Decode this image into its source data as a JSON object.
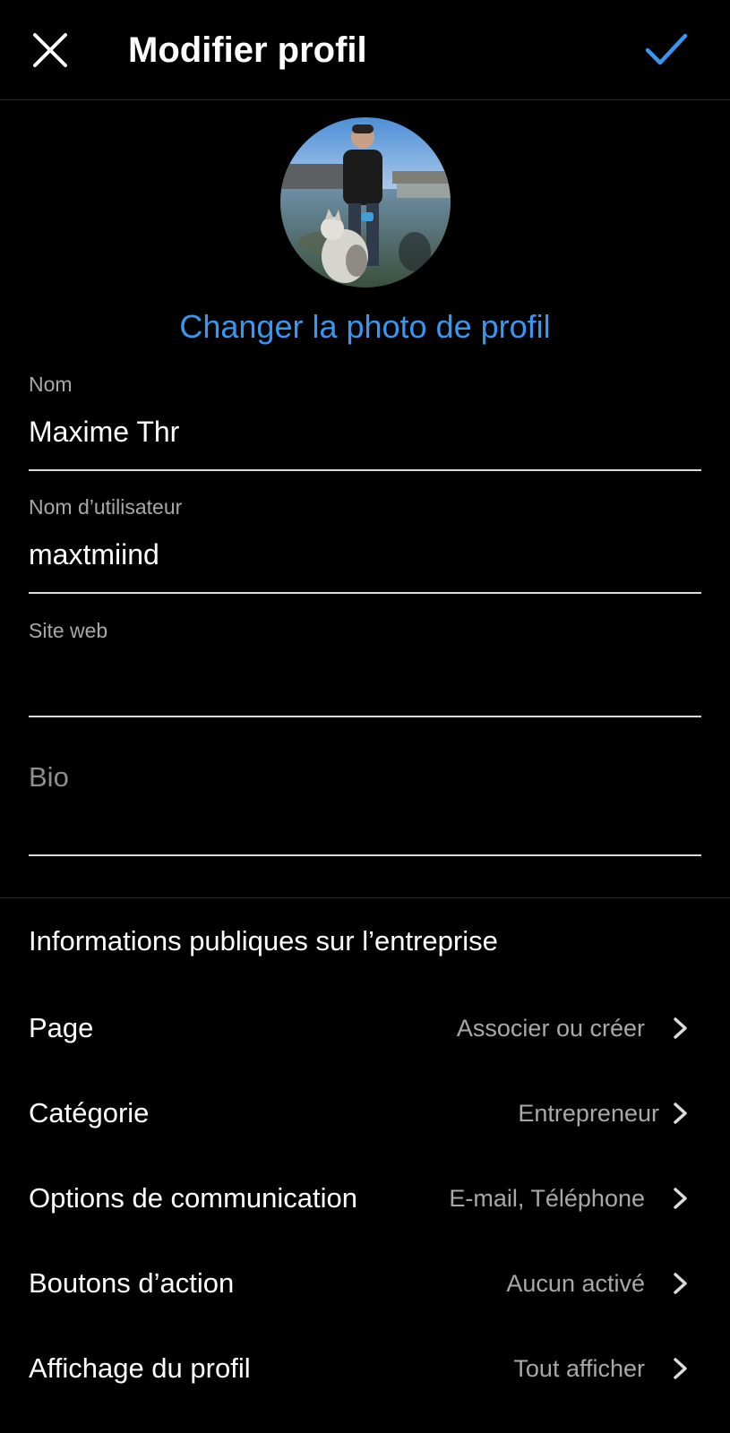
{
  "header": {
    "title": "Modifier profil",
    "close_icon": "close-icon",
    "confirm_icon": "checkmark-icon",
    "accent_color": "#3897f0"
  },
  "profile": {
    "avatar": "profile-photo",
    "change_photo_label": "Changer la photo de profil"
  },
  "fields": {
    "name": {
      "label": "Nom",
      "value": "Maxime Thr"
    },
    "username": {
      "label": "Nom d’utilisateur",
      "value": "maxtmiind"
    },
    "website": {
      "label": "Site web",
      "value": ""
    },
    "bio": {
      "placeholder": "Bio",
      "value": ""
    }
  },
  "business": {
    "section_title": "Informations publiques sur l’entreprise",
    "rows": [
      {
        "label": "Page",
        "value": "Associer ou créer"
      },
      {
        "label": "Catégorie",
        "value": "Entrepreneur"
      },
      {
        "label": "Options de communication",
        "value": "E-mail, Téléphone"
      },
      {
        "label": "Boutons d’action",
        "value": "Aucun activé"
      },
      {
        "label": "Affichage du profil",
        "value": "Tout afficher"
      }
    ],
    "chevron_icon": "chevron-right-icon"
  }
}
